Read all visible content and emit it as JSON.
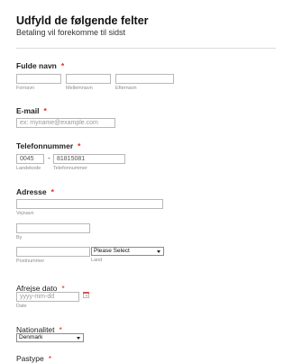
{
  "header": {
    "title": "Udfyld de følgende felter",
    "subtitle": "Betaling vil forekomme til sidst"
  },
  "required_marker": "*",
  "full_name": {
    "label": "Fulde navn",
    "first_sublabel": "Fornavn",
    "middle_sublabel": "Mellemnavn",
    "last_sublabel": "Efternavn"
  },
  "email": {
    "label": "E-mail",
    "placeholder": "ex: myname@example.com"
  },
  "phone": {
    "label": "Telefonnummer",
    "area_code": "0045",
    "separator": "-",
    "number": "81815081",
    "area_sublabel": "Landekode",
    "number_sublabel": "Telefonnummer"
  },
  "address": {
    "label": "Adresse",
    "street_sublabel": "Vejnavn",
    "city_sublabel": "By",
    "postcode_sublabel": "Postnummer",
    "country_sublabel": "Land",
    "country_select": "Please Select"
  },
  "departure": {
    "label": "Afrejse dato",
    "placeholder": "yyyy-mm-dd",
    "sublabel": "Date",
    "icon": "calendar-icon"
  },
  "nationality": {
    "label": "Nationalitet",
    "selected": "Denmark"
  },
  "passport": {
    "label": "Pastype"
  },
  "colors": {
    "required": "#e0251b",
    "input_border": "#b8b8b8",
    "sublabel": "#8c8c8c"
  }
}
